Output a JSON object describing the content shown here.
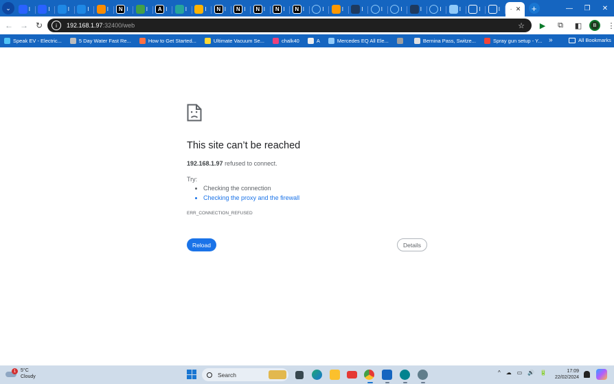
{
  "browser": {
    "tabs": [
      {
        "fav": "chat",
        "color": "#2962ff",
        "title": "I"
      },
      {
        "fav": "chat",
        "color": "#2962ff",
        "title": "I"
      },
      {
        "fav": "arrow",
        "color": "#1e88e5",
        "title": "I"
      },
      {
        "fav": "arrow",
        "color": "#1e88e5",
        "title": "I"
      },
      {
        "fav": "logo",
        "color": "#fb8c00",
        "title": "I"
      },
      {
        "fav": "N",
        "color": "#000000",
        "title": "I"
      },
      {
        "fav": "stripe",
        "color": "#43a047",
        "title": "I"
      },
      {
        "fav": "A",
        "color": "#000000",
        "title": "I"
      },
      {
        "fav": "grid",
        "color": "#26a69a",
        "title": "I"
      },
      {
        "fav": "chat",
        "color": "#ffb300",
        "title": "I"
      },
      {
        "fav": "N",
        "color": "#000000",
        "title": "I"
      },
      {
        "fav": "N",
        "color": "#000000",
        "title": "I"
      },
      {
        "fav": "N",
        "color": "#000000",
        "title": "I"
      },
      {
        "fav": "N",
        "color": "#000000",
        "title": "I"
      },
      {
        "fav": "N",
        "color": "#000000",
        "title": "I"
      },
      {
        "fav": "circle",
        "color": "#90caf9",
        "title": "I"
      },
      {
        "fav": "moon",
        "color": "#ff9800",
        "title": "I"
      },
      {
        "fav": "window",
        "color": "#1e3a5f",
        "title": "I"
      },
      {
        "fav": "circle",
        "color": "#90caf9",
        "title": "I"
      },
      {
        "fav": "circle",
        "color": "#90caf9",
        "title": "I"
      },
      {
        "fav": "window",
        "color": "#1e3a5f",
        "title": "I"
      },
      {
        "fav": "circle",
        "color": "#90caf9",
        "title": "I"
      },
      {
        "fav": "gear",
        "color": "#90caf9",
        "title": "I"
      },
      {
        "fav": "square",
        "color": "#ffffff",
        "title": "I"
      },
      {
        "fav": "square",
        "color": "#ffffff",
        "title": "I"
      }
    ],
    "active_tab": {
      "title": "·",
      "close": "✕"
    },
    "new_tab": "+",
    "window_controls": {
      "minimize": "—",
      "restore": "❐",
      "close": "✕"
    },
    "url_host": "192.168.1.97",
    "url_rest": ":32400/web",
    "star_icon": "star-icon",
    "bookmarks": [
      {
        "label": "Speak EV - Electric...",
        "color": "#4fc3f7"
      },
      {
        "label": "5 Day Water Fast Re...",
        "color": "#bdbdbd"
      },
      {
        "label": "How to Get Started...",
        "color": "#ff7043"
      },
      {
        "label": "Ultimate Vacuum Se...",
        "color": "#fdd835"
      },
      {
        "label": "chalk40",
        "color": "#ec407a"
      },
      {
        "label": "A",
        "color": "#eeeeee"
      },
      {
        "label": "Mercedes EQ All Ele...",
        "color": "#90caf9"
      },
      {
        "label": "",
        "color": "#9e9e9e"
      },
      {
        "label": "Bernina Pass, Switze...",
        "color": "#e0e0e0"
      },
      {
        "label": "Spray gun setup - Y...",
        "color": "#f44336"
      }
    ],
    "bookmarks_more": "»",
    "all_bookmarks": "All Bookmarks",
    "avatar_letter": "B"
  },
  "error_page": {
    "title": "This site can’t be reached",
    "host": "192.168.1.97",
    "message": " refused to connect.",
    "try_label": "Try:",
    "suggestions": [
      {
        "text": "Checking the connection",
        "link": false
      },
      {
        "text": "Checking the proxy and the firewall",
        "link": true
      }
    ],
    "error_code": "ERR_CONNECTION_REFUSED",
    "reload_label": "Reload",
    "details_label": "Details"
  },
  "taskbar": {
    "temperature": "5°C",
    "condition": "Cloudy",
    "weather_badge": "1",
    "search_placeholder": "Search",
    "time": "17:09",
    "date": "22/02/2024",
    "tray_icons": [
      "^",
      "☁",
      "▭",
      "🔊",
      "🔋"
    ]
  }
}
